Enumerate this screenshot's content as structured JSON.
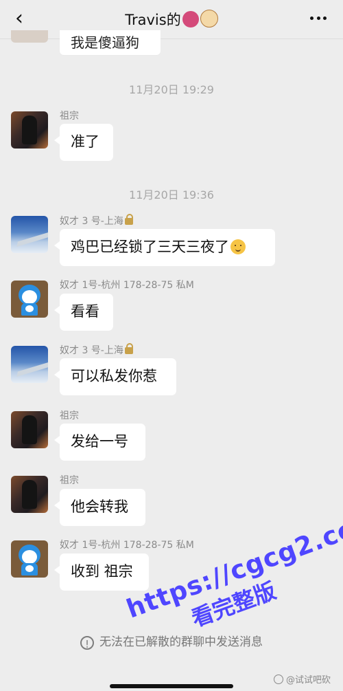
{
  "header": {
    "back_icon": "chevron-left-icon",
    "title": "Travis的",
    "title_emojis": [
      "devil-emoji-icon",
      "dog-emoji-icon"
    ],
    "more_icon": "more-icon"
  },
  "partial_message": {
    "text": "我是傻逼狗"
  },
  "timestamps": [
    "11月20日 19:29",
    "11月20日 19:36"
  ],
  "messages": [
    {
      "sender": "祖宗",
      "text": "准了",
      "avatar": "ancestor-avatar"
    },
    {
      "sender": "奴才 3 号-上海",
      "text": "鸡巴已经锁了三天三夜了",
      "avatar": "plane-avatar",
      "sender_icon": "lock-icon",
      "bubble_icon": "smiling-face-icon"
    },
    {
      "sender": "奴才 1号-杭州 178-28-75 私M",
      "text": "看看",
      "avatar": "doraemon-avatar"
    },
    {
      "sender": "奴才 3 号-上海",
      "text": "可以私发你惹",
      "avatar": "plane-avatar",
      "sender_icon": "lock-icon"
    },
    {
      "sender": "祖宗",
      "text": "发给一号",
      "avatar": "ancestor-avatar"
    },
    {
      "sender": "祖宗",
      "text": "他会转我",
      "avatar": "ancestor-avatar"
    },
    {
      "sender": "奴才 1号-杭州 178-28-75 私M",
      "text": "收到 祖宗",
      "avatar": "doraemon-avatar"
    }
  ],
  "notice": {
    "icon": "info-circle-icon",
    "text": "无法在已解散的群聊中发送消息"
  },
  "watermark": {
    "url": "https://cgcg2.co",
    "text": "看完整版"
  },
  "source": "@试试吧砍"
}
